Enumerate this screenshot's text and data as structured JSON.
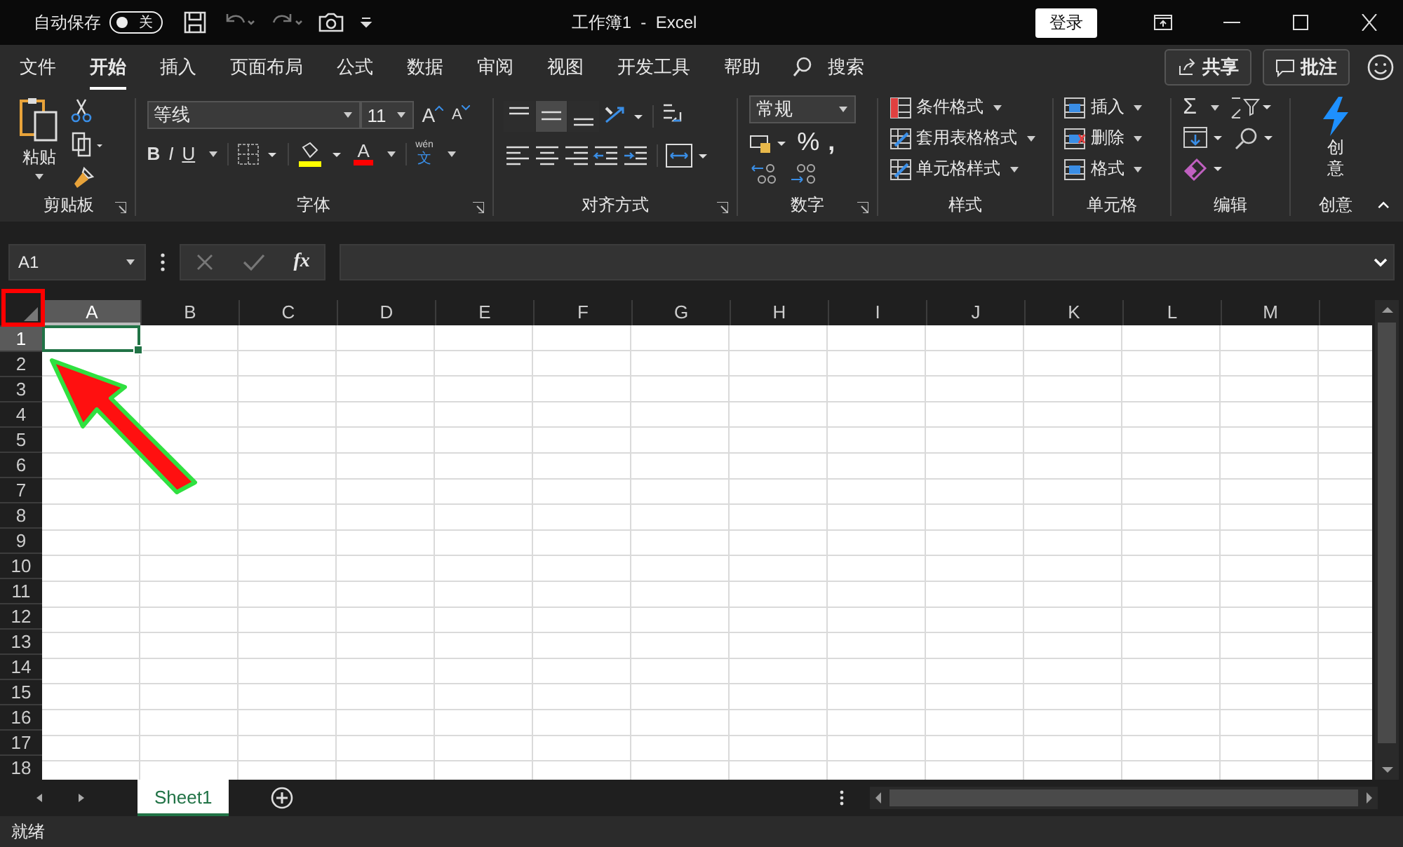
{
  "title_bar": {
    "autosave_label": "自动保存",
    "autosave": {
      "on": false,
      "label": "关"
    },
    "title": "工作簿1  -  Excel",
    "sign_in": "登录"
  },
  "tabs": [
    {
      "label": "文件",
      "selected": false
    },
    {
      "label": "开始",
      "selected": true
    },
    {
      "label": "插入",
      "selected": false
    },
    {
      "label": "页面布局",
      "selected": false
    },
    {
      "label": "公式",
      "selected": false
    },
    {
      "label": "数据",
      "selected": false
    },
    {
      "label": "审阅",
      "selected": false
    },
    {
      "label": "视图",
      "selected": false
    },
    {
      "label": "开发工具",
      "selected": false
    },
    {
      "label": "帮助",
      "selected": false
    }
  ],
  "search": "搜索",
  "share": "共享",
  "comments": "批注",
  "ribbon": {
    "clipboard": {
      "label": "剪贴板",
      "paste": "粘贴"
    },
    "font": {
      "label": "字体",
      "font_name": "等线",
      "font_size": "11",
      "grow": "A",
      "shrink": "A",
      "bold": "B",
      "italic": "I",
      "underline": "U",
      "font_color": "A",
      "phonetic": [
        "wén",
        "文"
      ]
    },
    "alignment": {
      "label": "对齐方式",
      "vertical": [
        {
          "selected": false
        },
        {
          "selected": true
        },
        {
          "selected": false
        }
      ]
    },
    "number": {
      "label": "数字",
      "format": "常规",
      "percent": "%",
      "comma": ","
    },
    "styles": {
      "label": "样式",
      "items": [
        "条件格式",
        "套用表格格式",
        "单元格样式"
      ]
    },
    "cells": {
      "label": "单元格",
      "items": [
        "插入",
        "删除",
        "格式"
      ]
    },
    "editing": {
      "label": "编辑",
      "sum": "Σ"
    },
    "ideas": {
      "label": "创意",
      "button": "创意"
    }
  },
  "formula_bar": {
    "name_box": "A1",
    "fx": "fx"
  },
  "columns": [
    {
      "label": "A",
      "selected": true
    },
    {
      "label": "B",
      "selected": false
    },
    {
      "label": "C",
      "selected": false
    },
    {
      "label": "D",
      "selected": false
    },
    {
      "label": "E",
      "selected": false
    },
    {
      "label": "F",
      "selected": false
    },
    {
      "label": "G",
      "selected": false
    },
    {
      "label": "H",
      "selected": false
    },
    {
      "label": "I",
      "selected": false
    },
    {
      "label": "J",
      "selected": false
    },
    {
      "label": "K",
      "selected": false
    },
    {
      "label": "L",
      "selected": false
    },
    {
      "label": "M",
      "selected": false
    }
  ],
  "rows": [
    {
      "label": "1",
      "selected": true
    },
    {
      "label": "2",
      "selected": false
    },
    {
      "label": "3",
      "selected": false
    },
    {
      "label": "4",
      "selected": false
    },
    {
      "label": "5",
      "selected": false
    },
    {
      "label": "6",
      "selected": false
    },
    {
      "label": "7",
      "selected": false
    },
    {
      "label": "8",
      "selected": false
    },
    {
      "label": "9",
      "selected": false
    },
    {
      "label": "10",
      "selected": false
    },
    {
      "label": "11",
      "selected": false
    },
    {
      "label": "12",
      "selected": false
    },
    {
      "label": "13",
      "selected": false
    },
    {
      "label": "14",
      "selected": false
    },
    {
      "label": "15",
      "selected": false
    },
    {
      "label": "16",
      "selected": false
    },
    {
      "label": "17",
      "selected": false
    },
    {
      "label": "18",
      "selected": false
    }
  ],
  "sheets": [
    {
      "label": "Sheet1",
      "selected": true
    }
  ],
  "status": "就绪",
  "annotations": {
    "highlight_box": true,
    "pointer_arrow": true
  }
}
